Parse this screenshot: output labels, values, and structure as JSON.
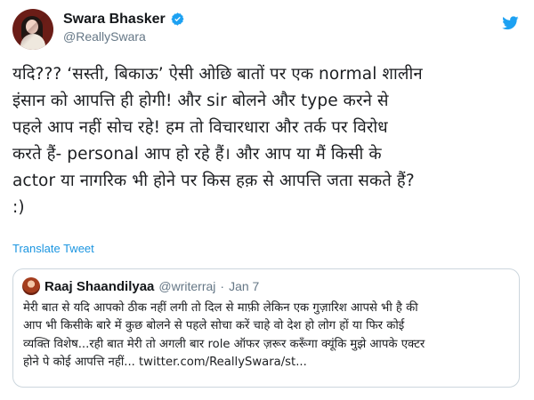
{
  "tweet": {
    "author": {
      "display_name": "Swara Bhasker",
      "handle": "@ReallySwara"
    },
    "text_lines": [
      "यदि??? ‘सस्ती, बिकाऊ’ ऐसी ओछि बातों पर एक normal शालीन",
      "इंसान को आपत्ति ही होगी! और sir बोलने और type करने से",
      "पहले आप नहीं सोच रहे! हम तो विचारधारा और तर्क पर विरोध",
      "करते हैं- personal आप हो रहे हैं। और आप या मैं किसी के",
      "actor या नागरिक भी होने पर किस हक़ से आपत्ति जता सकते हैं?",
      ":)"
    ],
    "translate_label": "Translate Tweet"
  },
  "quoted_tweet": {
    "display_name": "Raaj Shaandilyaa",
    "handle": "@writerraj",
    "separator": "·",
    "date": "Jan 7",
    "text_lines": [
      "मेरी बात से यदि आपको ठीक नहीं लगी तो दिल से माफ़ी लेकिन एक गुज़ारिश आपसे भी है की",
      "आप भी किसीके बारे में कुछ बोलने से पहले सोचा करें चाहे वो देश हो लोग हों या फिर कोई",
      "व्यक्ति विशेष...रही बात मेरी तो अगली बार role ऑफर ज़रूर करूँगा क्यूंकि मुझे आपके एक्टर",
      "होने पे कोई आपत्ति नहीं... twitter.com/ReallySwara/st..."
    ]
  },
  "icons": {
    "verified": "verified-badge-icon",
    "brand": "twitter-bird-icon"
  },
  "colors": {
    "link": "#1b95e0",
    "verified": "#1da1f2",
    "brand": "#1da1f2",
    "border": "#ccd6dd",
    "secondary_text": "#657786"
  }
}
